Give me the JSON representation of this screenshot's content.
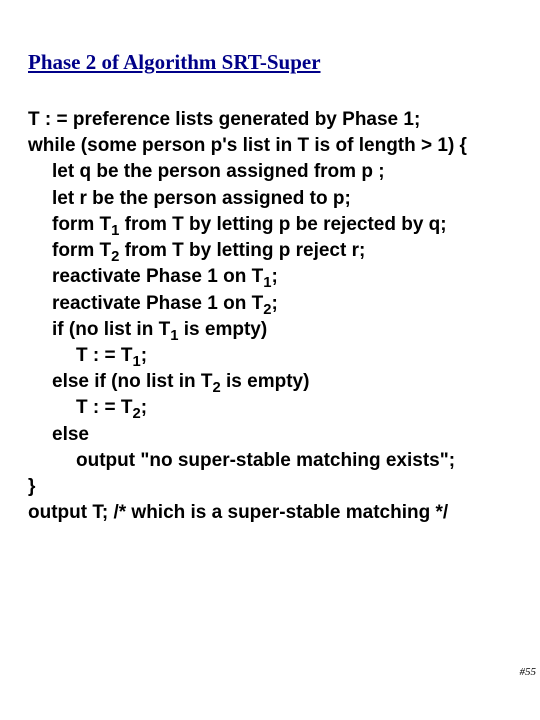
{
  "title": "Phase 2 of Algorithm SRT-Super",
  "lines": {
    "l0": "T : = preference lists generated by Phase 1;",
    "l1a": "while",
    "l1b": " (some person p's list in T is of length > 1) {",
    "l2": "let q be the person assigned from p ;",
    "l3": "let r be the person assigned to p;",
    "l4a": "form T",
    "l4b": " from T by letting p be rejected by q;",
    "l5a": "form T",
    "l5b": " from T by letting p reject r;",
    "l6a": "reactivate Phase 1 on T",
    "l6b": ";",
    "l7a": "reactivate Phase 1 on T",
    "l7b": ";",
    "l8a": "if",
    "l8b": " (no list in T",
    "l8c": " is empty)",
    "l9a": "  T : = T",
    "l9b": ";",
    "l10a": "else if",
    "l10b": " (no list in T",
    "l10c": " is empty)",
    "l11a": "  T : = T",
    "l11b": ";",
    "l12": "else",
    "l13": "  output \"no super-stable matching exists\";",
    "l14": "}",
    "l15": "output T;    /* which is a super-stable matching */"
  },
  "subs": {
    "one": "1",
    "two": "2"
  },
  "page": "#55"
}
